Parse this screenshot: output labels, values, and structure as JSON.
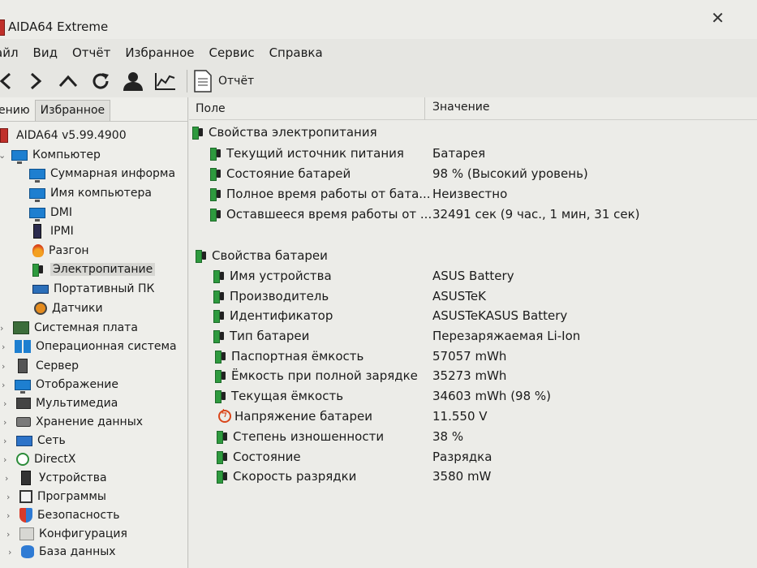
{
  "window": {
    "title": "AIDA64 Extreme",
    "close_glyph": "✕"
  },
  "menu": [
    "Файл",
    "Вид",
    "Отчёт",
    "Избранное",
    "Сервис",
    "Справка"
  ],
  "menu_visible": [
    "айл",
    "Вид",
    "Отчёт",
    "Избранное",
    "Сервис",
    "Справка"
  ],
  "toolbar": {
    "report_label": "Отчёт"
  },
  "left_tabs": {
    "menu": "ению",
    "favorites": "Избранное"
  },
  "tree": [
    {
      "label": "AIDA64 v5.99.4900",
      "icon": "aida-icon"
    },
    {
      "label": "Компьютер",
      "icon": "monitor-icon"
    },
    {
      "label": "Суммарная информа",
      "icon": "monitor-icon"
    },
    {
      "label": "Имя компьютера",
      "icon": "monitor-icon"
    },
    {
      "label": "DMI",
      "icon": "monitor-icon"
    },
    {
      "label": "IPMI",
      "icon": "chip-icon"
    },
    {
      "label": "Разгон",
      "icon": "flame-icon"
    },
    {
      "label": "Электропитание",
      "icon": "battery-icon"
    },
    {
      "label": "Портативный ПК",
      "icon": "laptop-icon"
    },
    {
      "label": "Датчики",
      "icon": "gauge-icon"
    },
    {
      "label": "Системная плата",
      "icon": "motherboard-icon"
    },
    {
      "label": "Операционная система",
      "icon": "windows-icon"
    },
    {
      "label": "Сервер",
      "icon": "server-icon"
    },
    {
      "label": "Отображение",
      "icon": "monitor-icon"
    },
    {
      "label": "Мультимедиа",
      "icon": "multimedia-icon"
    },
    {
      "label": "Хранение данных",
      "icon": "storage-icon"
    },
    {
      "label": "Сеть",
      "icon": "network-icon"
    },
    {
      "label": "DirectX",
      "icon": "xbox-icon"
    },
    {
      "label": "Устройства",
      "icon": "devices-icon"
    },
    {
      "label": "Программы",
      "icon": "programs-icon"
    },
    {
      "label": "Безопасность",
      "icon": "shield-icon"
    },
    {
      "label": "Конфигурация",
      "icon": "config-icon"
    },
    {
      "label": "База данных",
      "icon": "database-icon"
    }
  ],
  "table": {
    "col_field": "Поле",
    "col_value": "Значение",
    "power_section": "Свойства электропитания",
    "power_rows": [
      {
        "field": "Текущий источник питания",
        "value": "Батарея"
      },
      {
        "field": "Состояние батарей",
        "value": "98 % (Высокий уровень)"
      },
      {
        "field": "Полное время работы от бата...",
        "value": "Неизвестно"
      },
      {
        "field": "Оставшееся время работы от ...",
        "value": "32491 сек (9 час., 1 мин, 31 сек)"
      }
    ],
    "battery_section": "Свойства батареи",
    "battery_rows": [
      {
        "field": "Имя устройства",
        "value": "ASUS Battery",
        "icon": "battery-icon"
      },
      {
        "field": "Производитель",
        "value": "ASUSTeK",
        "icon": "battery-icon"
      },
      {
        "field": "Идентификатор",
        "value": "ASUSTeKASUS Battery",
        "icon": "battery-icon"
      },
      {
        "field": "Тип батареи",
        "value": "Перезаряжаемая Li-Ion",
        "icon": "battery-icon"
      },
      {
        "field": "Паспортная ёмкость",
        "value": "57057 mWh",
        "icon": "battery-icon"
      },
      {
        "field": "Ёмкость при полной зарядке",
        "value": "35273 mWh",
        "icon": "battery-icon"
      },
      {
        "field": "Текущая ёмкость",
        "value": "34603 mWh  (98 %)",
        "icon": "battery-icon"
      },
      {
        "field": "Напряжение батареи",
        "value": "11.550 V",
        "icon": "voltage-icon"
      },
      {
        "field": "Степень изношенности",
        "value": "38 %",
        "icon": "battery-icon"
      },
      {
        "field": "Состояние",
        "value": "Разрядка",
        "icon": "battery-icon"
      },
      {
        "field": "Скорость разрядки",
        "value": "3580 mW",
        "icon": "battery-icon"
      }
    ]
  }
}
